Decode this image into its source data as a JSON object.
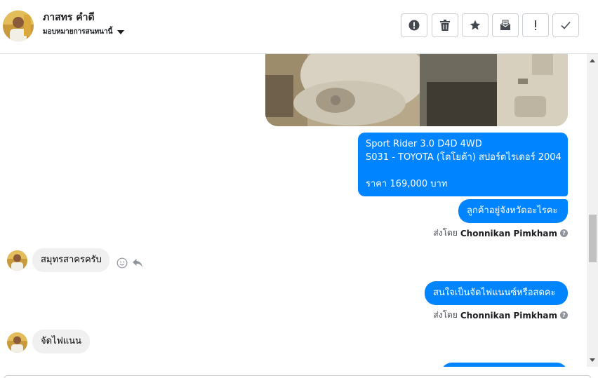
{
  "header": {
    "contact_name": "ภาสทร คำดี",
    "assign_label": "มอบหมายการสนทนานี้",
    "toolbar_icons": [
      "alert-circle-icon",
      "trash-icon",
      "star-icon",
      "mark-unread-icon",
      "exclamation-icon",
      "check-icon"
    ]
  },
  "messages": {
    "car_details": {
      "line1": "Sport Rider 3.0 D4D 4WD",
      "line2": "S031 - TOYOTA (โตโยต้า) สปอร์ตไรเดอร์ 2004",
      "line3": "ราคา 169,000 บาท"
    },
    "ask_province": "ลูกค้าอยู่จังหวัดอะไรคะ",
    "sent_by_1": {
      "prefix": "ส่งโดย",
      "agent": "Chonnikan Pimkham"
    },
    "reply_province": "สมุทรสาครครับ",
    "ask_headlight": "สนใจเป็นจัดไฟแนนซ์หรือสดคะ",
    "sent_by_2": {
      "prefix": "ส่งโดย",
      "agent": "Chonnikan Pimkham"
    },
    "reply_finance": "จัดไฟแนน"
  },
  "colors": {
    "outgoing_bubble": "#0084ff",
    "incoming_bubble": "#f0f0f0"
  }
}
